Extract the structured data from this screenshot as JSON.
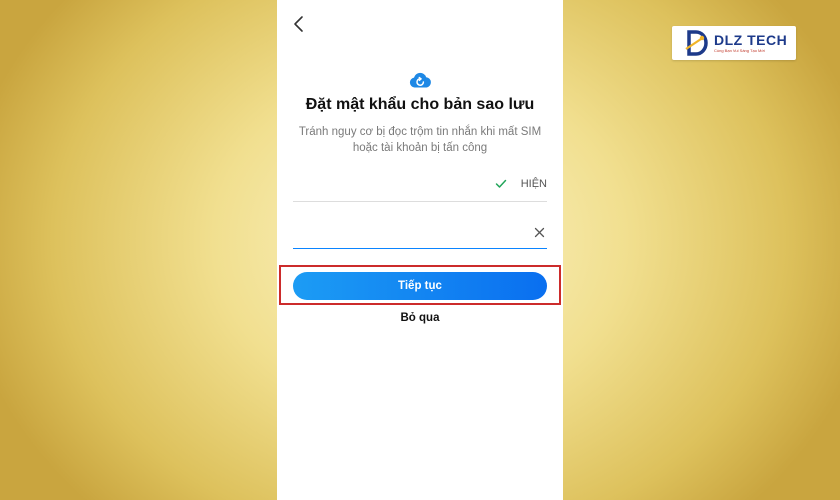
{
  "logo": {
    "text": "DLZ TECH",
    "tagline": "Cùng Bạn Vui Sáng Tạo Mới"
  },
  "screen": {
    "title": "Đặt mật khẩu cho bản sao lưu",
    "subtitle": "Tránh nguy cơ bị đọc trộm tin nhắn khi mất SIM hoặc tài khoản bị tấn công",
    "password_field": {
      "toggle_label": "HIỆN"
    },
    "confirm_field": {},
    "continue_label": "Tiếp tục",
    "skip_label": "Bỏ qua"
  },
  "colors": {
    "accent": "#0a84ff",
    "button_gradient_start": "#1c9cf4",
    "button_gradient_end": "#0a6ff0",
    "highlight_border": "#cc2b2b",
    "check_green": "#22a55a",
    "background_gold": "#e8cf74"
  },
  "icons": {
    "back": "chevron-left-icon",
    "cloud": "cloud-backup-icon",
    "check": "check-icon",
    "clear": "clear-icon",
    "logo": "dlz-logo-icon"
  }
}
